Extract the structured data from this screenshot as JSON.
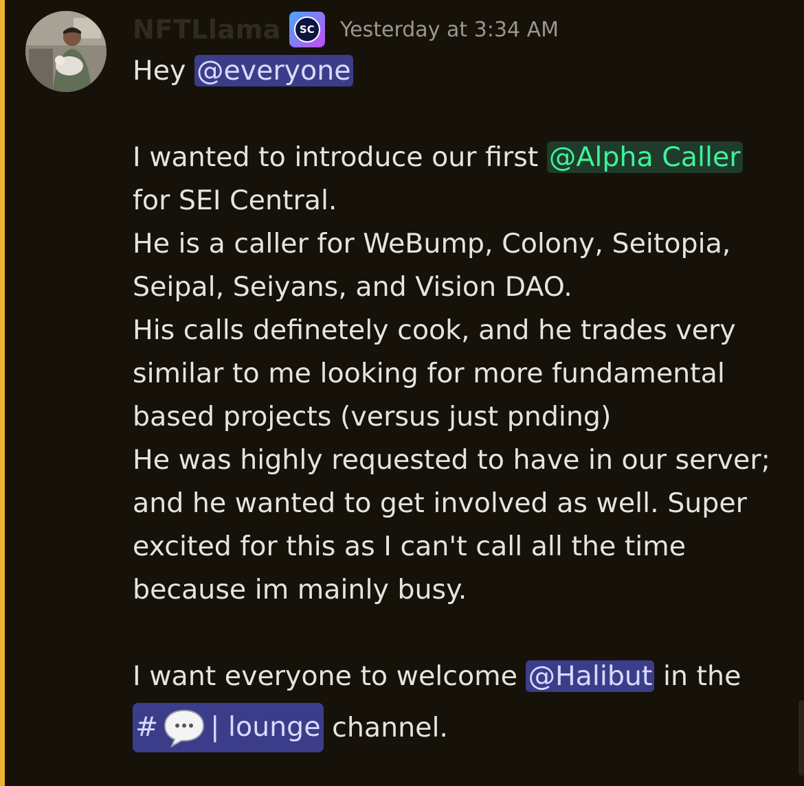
{
  "message": {
    "author": {
      "username": "NFTLlama",
      "badge_text": "SC",
      "badge_icon": "server-tag-badge-icon"
    },
    "timestamp": "Yesterday at 3:34 AM",
    "lines": {
      "l1_prefix": "Hey ",
      "l1_mention": "@everyone",
      "l3_prefix": "I wanted to introduce our first ",
      "l3_role": "@Alpha Caller",
      "l4": "for SEI Central.",
      "l5": "He is a caller for WeBump, Colony, Seitopia,",
      "l6": "Seipal, Seiyans, and Vision DAO.",
      "l7": "His calls definetely cook, and he trades very",
      "l8": "similar to me looking for more fundamental",
      "l9": "based projects (versus just pnding)",
      "l10": "He was highly requested to have in our server;",
      "l11": "and he wanted to get involved as well. Super",
      "l12": "excited for this as I can't call all the time",
      "l13": "because im mainly busy.",
      "l15_prefix": "I want everyone to welcome ",
      "l15_mention": "@Halibut",
      "l15_suffix": " in the",
      "l16_channel_hash": "#",
      "l16_channel_name": "| lounge",
      "l16_suffix": " channel."
    }
  },
  "colors": {
    "background": "#161209",
    "mention_highlight_bar": "#f0b232",
    "user_mention_bg": "#3c3d8a",
    "role_mention_text": "#3ef39a",
    "timestamp": "#9b978f"
  }
}
